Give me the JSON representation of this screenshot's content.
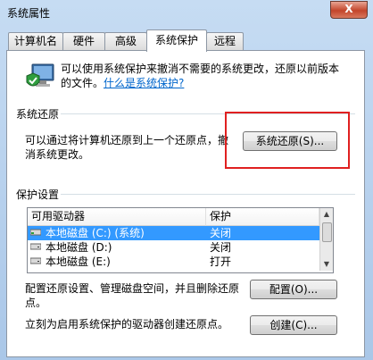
{
  "window": {
    "title": "系统属性",
    "close_label": "X"
  },
  "tabs": [
    {
      "label": "计算机名"
    },
    {
      "label": "硬件"
    },
    {
      "label": "高级"
    },
    {
      "label": "系统保护",
      "active": true
    },
    {
      "label": "远程"
    }
  ],
  "intro": {
    "text": "可以使用系统保护来撤消不需要的系统更改，还原以前版本的文件。",
    "link": "什么是系统保护?"
  },
  "restore": {
    "group_label": "系统还原",
    "description": "可以通过将计算机还原到上一个还原点，撤消系统更改。",
    "button": "系统还原(S)..."
  },
  "protection": {
    "group_label": "保护设置",
    "columns": [
      "可用驱动器",
      "保护"
    ],
    "rows": [
      {
        "drive": "本地磁盘 (C:) (系统)",
        "status": "关闭",
        "selected": true
      },
      {
        "drive": "本地磁盘 (D:)",
        "status": "关闭",
        "selected": false
      },
      {
        "drive": "本地磁盘 (E:)",
        "status": "打开",
        "selected": false
      }
    ]
  },
  "configure": {
    "text": "配置还原设置、管理磁盘空间，并且删除还原点。",
    "button": "配置(O)..."
  },
  "create": {
    "text": "立刻为启用系统保护的驱动器创建还原点。",
    "button": "创建(C)..."
  },
  "colors": {
    "highlight": "#e02020",
    "selection": "#3399ff",
    "link": "#0066cc"
  }
}
